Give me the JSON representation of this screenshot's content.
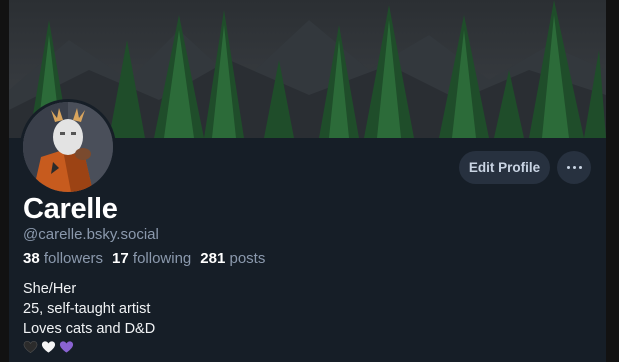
{
  "profile": {
    "display_name": "Carelle",
    "handle": "@carelle.bsky.social"
  },
  "stats": {
    "followers_count": "38",
    "followers_label": "followers",
    "following_count": "17",
    "following_label": "following",
    "posts_count": "281",
    "posts_label": "posts"
  },
  "actions": {
    "edit_profile_label": "Edit Profile",
    "more_icon": "ellipsis-icon"
  },
  "bio": {
    "lines": [
      "She/Her",
      "25, self-taught artist",
      "Loves cats and D&D"
    ],
    "hearts": [
      {
        "icon": "black-heart-icon",
        "color": "#2b2b2b"
      },
      {
        "icon": "white-heart-icon",
        "color": "#f5f5f5"
      },
      {
        "icon": "purple-heart-icon",
        "color": "#8a63d2"
      }
    ]
  },
  "colors": {
    "background": "#161e27",
    "button_bg": "#27313f",
    "secondary_text": "#8b99ad"
  }
}
